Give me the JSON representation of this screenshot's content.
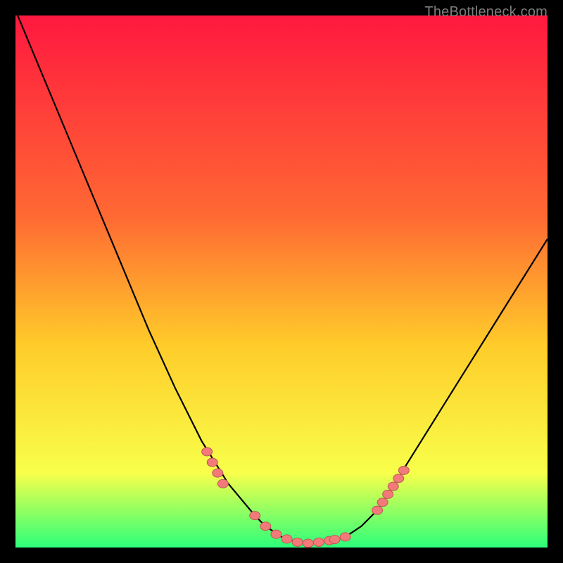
{
  "watermark": "TheBottleneck.com",
  "colors": {
    "background": "#000000",
    "gradient_top": "#ff183f",
    "gradient_mid1": "#ff6a33",
    "gradient_mid2": "#ffcc2a",
    "gradient_mid3": "#f8ff4a",
    "gradient_bottom": "#2cff7a",
    "curve": "#000000",
    "bead_fill": "#f27a78",
    "bead_stroke": "#bd5a56"
  },
  "chart_data": {
    "type": "line",
    "title": "",
    "xlabel": "",
    "ylabel": "",
    "xlim": [
      0,
      100
    ],
    "ylim": [
      0,
      100
    ],
    "grid": false,
    "legend": false,
    "x": [
      0,
      5,
      10,
      15,
      20,
      25,
      30,
      35,
      40,
      45,
      47,
      50,
      53,
      55,
      58,
      60,
      62,
      65,
      68,
      70,
      75,
      80,
      85,
      90,
      95,
      100
    ],
    "y": [
      101,
      89,
      77,
      65,
      53,
      41,
      30,
      20,
      12,
      6,
      4,
      2,
      1,
      0.8,
      1,
      1.3,
      2,
      4,
      7,
      10,
      18,
      26,
      34,
      42,
      50,
      58
    ],
    "beads": [
      {
        "x": 36,
        "y": 18
      },
      {
        "x": 37,
        "y": 16
      },
      {
        "x": 38,
        "y": 14
      },
      {
        "x": 39,
        "y": 12
      },
      {
        "x": 45,
        "y": 6
      },
      {
        "x": 47,
        "y": 4
      },
      {
        "x": 49,
        "y": 2.5
      },
      {
        "x": 51,
        "y": 1.6
      },
      {
        "x": 53,
        "y": 1
      },
      {
        "x": 55,
        "y": 0.8
      },
      {
        "x": 57,
        "y": 1
      },
      {
        "x": 59,
        "y": 1.3
      },
      {
        "x": 60,
        "y": 1.5
      },
      {
        "x": 62,
        "y": 2
      },
      {
        "x": 68,
        "y": 7
      },
      {
        "x": 69,
        "y": 8.5
      },
      {
        "x": 70,
        "y": 10
      },
      {
        "x": 71,
        "y": 11.5
      },
      {
        "x": 72,
        "y": 13
      },
      {
        "x": 73,
        "y": 14.5
      }
    ]
  }
}
